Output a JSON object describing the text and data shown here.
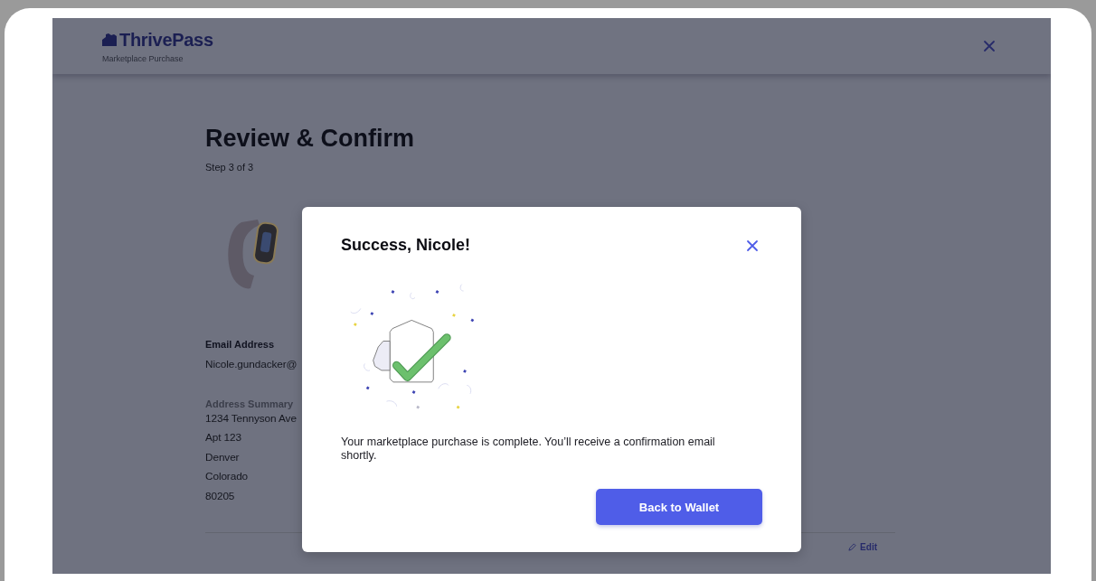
{
  "header": {
    "brand": "ThrivePass",
    "subtitle": "Marketplace Purchase"
  },
  "page": {
    "title": "Review & Confirm",
    "step": "Step 3 of 3",
    "email": {
      "label": "Email Address",
      "value": "Nicole.gundacker@"
    },
    "address": {
      "label": "Address Summary",
      "lines": [
        "1234 Tennyson Ave",
        "Apt 123",
        "Denver",
        "Colorado",
        "80205"
      ]
    },
    "edit_link": "Edit"
  },
  "modal": {
    "title": "Success, Nicole!",
    "message": "Your marketplace purchase is complete. You’ll receive a confirmation email shortly.",
    "button": "Back to Wallet"
  }
}
